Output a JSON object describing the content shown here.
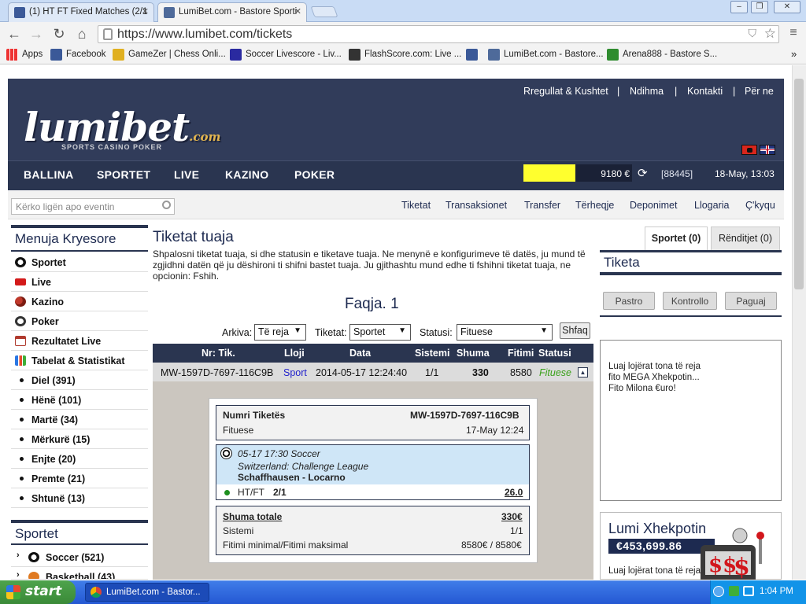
{
  "browser": {
    "tabs": [
      {
        "title": "(1) HT FT Fixed Matches (2/1"
      },
      {
        "title": "LumiBet.com - Bastore Sporti"
      }
    ],
    "url": "https://www.lumibet.com/tickets",
    "bookmarks": [
      {
        "label": "Apps"
      },
      {
        "label": "Facebook"
      },
      {
        "label": "GameZer | Chess Onli..."
      },
      {
        "label": "Soccer Livescore - Liv..."
      },
      {
        "label": "FlashScore.com: Live ..."
      },
      {
        "label": ""
      },
      {
        "label": "LumiBet.com - Bastore..."
      },
      {
        "label": "Arena888 - Bastore S..."
      }
    ],
    "more": "»"
  },
  "site": {
    "logo": "lumibet",
    "logo_suffix": ".com",
    "logo_tagline": "SPORTS CASINO POKER",
    "top_links": [
      "Rregullat & Kushtet",
      "Ndihma",
      "Kontakti",
      "Për ne"
    ],
    "nav": [
      "BALLINA",
      "SPORTET",
      "LIVE",
      "KAZINO",
      "POKER"
    ],
    "balance": "9180 €",
    "account": "[88445]",
    "datetime": "18-May, 13:03",
    "search_placeholder": "Kërko ligën apo eventin",
    "sub_links": [
      "Tiketat",
      "Transaksionet",
      "Transfer",
      "Tërheqje",
      "Deponimet",
      "Llogaria",
      "Ç'kyqu"
    ]
  },
  "left_menu": {
    "title": "Menuja Kryesore",
    "items": [
      "Sportet",
      "Live",
      "Kazino",
      "Poker",
      "Rezultatet Live",
      "Tabelat & Statistikat"
    ],
    "days": [
      {
        "label": "Diel",
        "count": "(391)"
      },
      {
        "label": "Hënë",
        "count": "(101)"
      },
      {
        "label": "Martë",
        "count": "(34)"
      },
      {
        "label": "Mërkurë",
        "count": "(15)"
      },
      {
        "label": "Enjte",
        "count": "(20)"
      },
      {
        "label": "Premte",
        "count": "(21)"
      },
      {
        "label": "Shtunë",
        "count": "(13)"
      }
    ],
    "sport_title": "Sportet",
    "sports": [
      {
        "label": "Soccer",
        "count": "(521)"
      },
      {
        "label": "Basketball",
        "count": "(43)"
      }
    ]
  },
  "tickets": {
    "title": "Tiketat tuaja",
    "description": "Shpalosni tiketat tuaja, si dhe statusin e tiketave tuaja. Ne menynë e konfigurimeve të datës, ju mund të zgjidhni datën që ju dëshironi ti shifni bastet tuaja. Ju gjithashtu mund edhe ti fshihni tiketat tuaja, ne opcionin: Fshih.",
    "page": "Faqja. 1",
    "filters": {
      "arkiva_label": "Arkiva:",
      "arkiva_value": "Të reja",
      "tiketat_label": "Tiketat:",
      "tiketat_value": "Sportet",
      "statusi_label": "Statusi:",
      "statusi_value": "Fituese",
      "button": "Shfaq"
    },
    "columns": [
      "Nr: Tik.",
      "Lloji",
      "Data",
      "Sistemi",
      "Shuma",
      "Fitimi",
      "Statusi"
    ],
    "row": {
      "nr": "MW-1597D-7697-116C9B",
      "lloji": "Sport",
      "data": "2014-05-17 12:24:40",
      "sistemi": "1/1",
      "shuma": "330",
      "fitimi": "8580",
      "statusi": "Fituese"
    },
    "detail": {
      "nr_label": "Numri Tiketës",
      "nr_value": "MW-1597D-7697-116C9B",
      "status": "Fituese",
      "date": "17-May 12:24",
      "event_time": "05-17 17:30 Soccer",
      "league": "Switzerland: Challenge League",
      "match": "Schaffhausen - Locarno",
      "market": "HT/FT",
      "pick": "2/1",
      "odds": "26.0",
      "total_label": "Shuma totale",
      "total_value": "330€",
      "system_label": "Sistemi",
      "system_value": "1/1",
      "minmax_label": "Fitimi minimal/Fitimi maksimal",
      "minmax_value": "8580€ / 8580€"
    }
  },
  "right": {
    "tab_sport": "Sportet (0)",
    "tab_order": "Rënditjet (0)",
    "ticket_title": "Tiketa",
    "buttons": [
      "Pastro",
      "Kontrollo",
      "Paguaj"
    ],
    "promo_lines": [
      "Luaj lojërat tona të reja",
      "fito MEGA Xhekpotin...",
      "Fito Milona €uro!"
    ],
    "jackpot_title": "Lumi Xhekpotin",
    "jackpot_amount": "€453,699.86",
    "jackpot_text": "Luaj lojërat tona të reja"
  },
  "taskbar": {
    "start": "start",
    "item": "LumiBet.com - Bastor...",
    "clock": "1:04 PM"
  },
  "colors": {
    "navy": "#2a3550",
    "header": "#313c5a",
    "balance_bar": "#ffff2e",
    "status_green": "#3aa11a",
    "sport_blue": "#2222cc"
  }
}
